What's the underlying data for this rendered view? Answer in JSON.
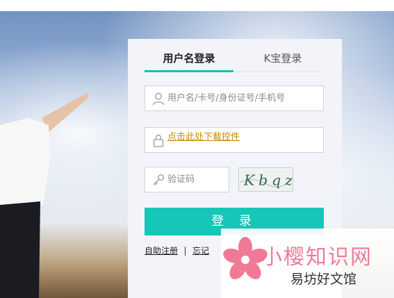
{
  "tabs": {
    "username_login": "用户名登录",
    "kbao_login": "K宝登录"
  },
  "form": {
    "username_placeholder": "用户名/卡号/身份证号/手机号",
    "password_plugin_link": "点击此处下载控件",
    "captcha_placeholder": "验证码",
    "captcha_text": "Kbqz",
    "login_button": "登 录"
  },
  "links": {
    "self_register": "自助注册",
    "forgot": "忘记"
  },
  "watermark": {
    "brand": "小樱知识网",
    "sub": "易坊好文馆"
  },
  "colors": {
    "accent": "#16c6b6",
    "tab_underline": "#16c2b0",
    "plugin_link": "#c58a00",
    "watermark_pink": "#f07a96"
  },
  "icons": {
    "username": "user-icon",
    "password": "lock-icon",
    "captcha": "key-icon",
    "watermark": "sakura-flower-icon"
  }
}
